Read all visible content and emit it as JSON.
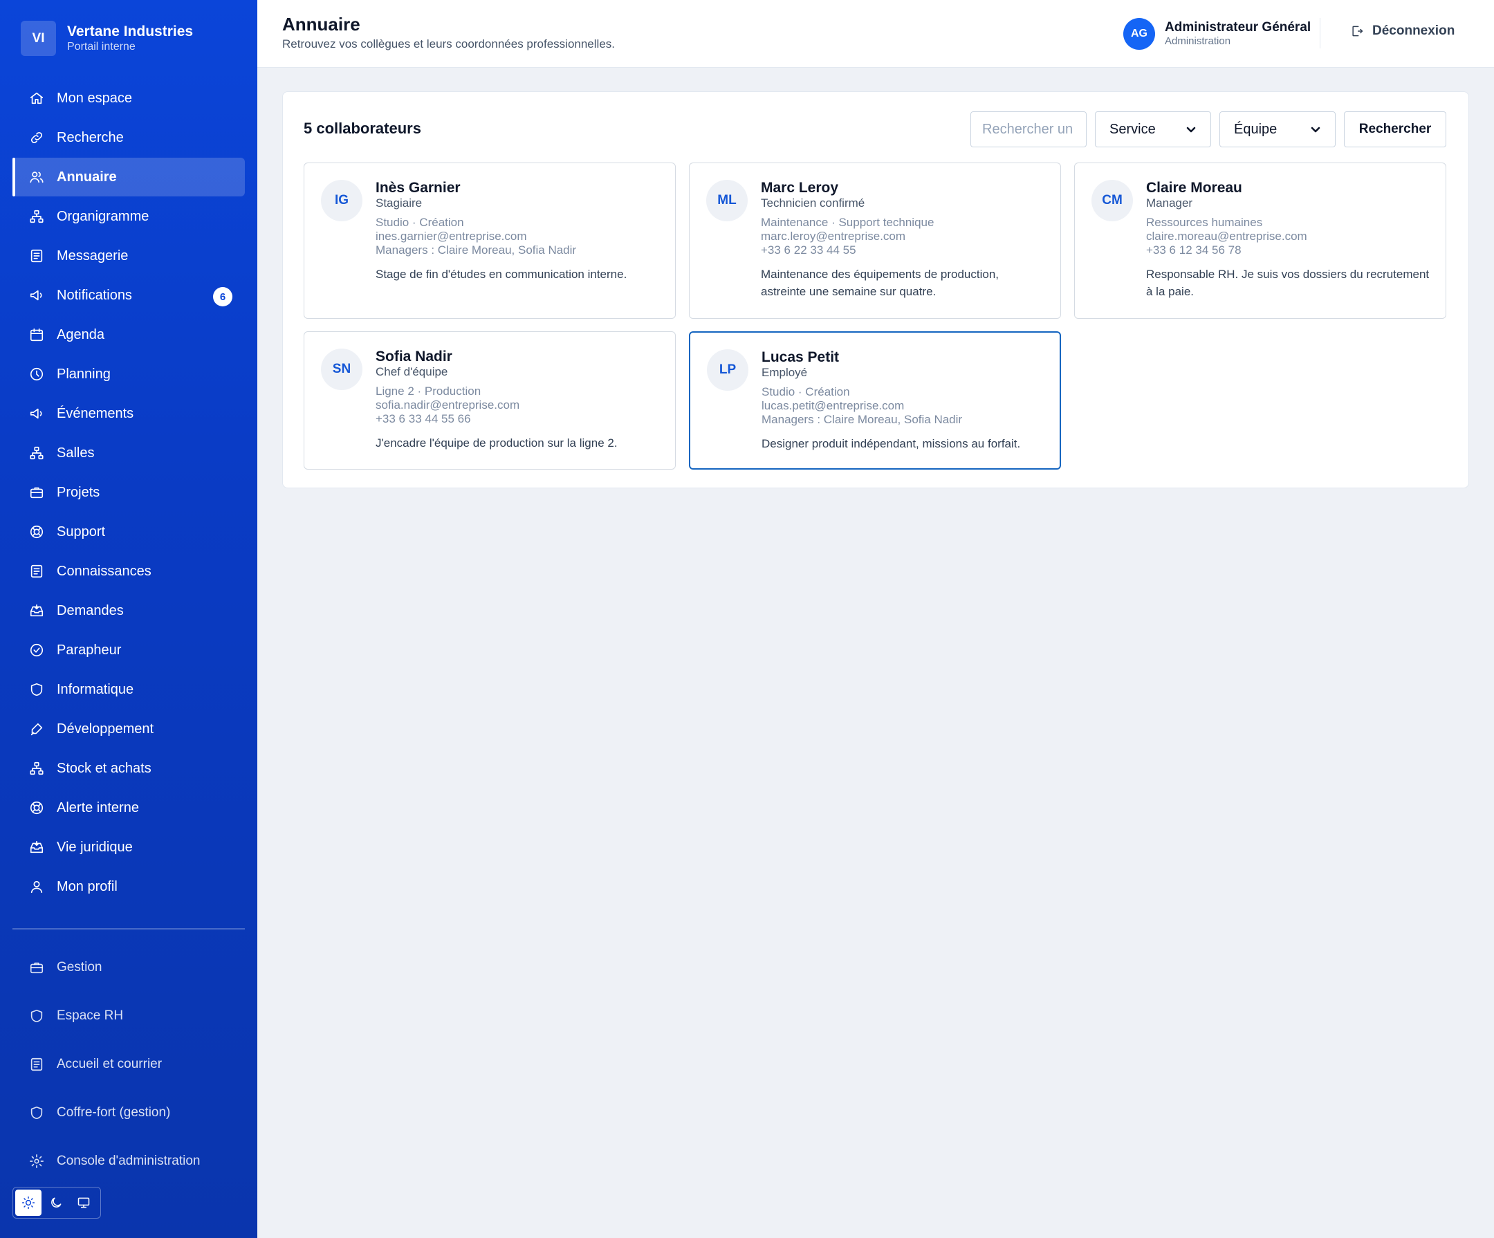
{
  "brand": {
    "initials": "VI",
    "name": "Vertane Industries",
    "subtitle": "Portail interne"
  },
  "nav": [
    {
      "label": "Mon espace",
      "icon": "home-icon"
    },
    {
      "label": "Recherche",
      "icon": "link-icon"
    },
    {
      "label": "Annuaire",
      "icon": "users-icon",
      "active": true
    },
    {
      "label": "Organigramme",
      "icon": "org-chart-icon"
    },
    {
      "label": "Messagerie",
      "icon": "document-icon"
    },
    {
      "label": "Notifications",
      "icon": "megaphone-icon",
      "badge": "6"
    },
    {
      "label": "Agenda",
      "icon": "calendar-icon"
    },
    {
      "label": "Planning",
      "icon": "clock-icon"
    },
    {
      "label": "Événements",
      "icon": "megaphone-icon"
    },
    {
      "label": "Salles",
      "icon": "org-chart-icon"
    },
    {
      "label": "Projets",
      "icon": "briefcase-icon"
    },
    {
      "label": "Support",
      "icon": "lifebuoy-icon"
    },
    {
      "label": "Connaissances",
      "icon": "document-icon"
    },
    {
      "label": "Demandes",
      "icon": "inbox-icon"
    },
    {
      "label": "Parapheur",
      "icon": "check-circle-icon"
    },
    {
      "label": "Informatique",
      "icon": "shield-icon"
    },
    {
      "label": "Développement",
      "icon": "pen-icon"
    },
    {
      "label": "Stock et achats",
      "icon": "org-chart-icon"
    },
    {
      "label": "Alerte interne",
      "icon": "lifebuoy-icon"
    },
    {
      "label": "Vie juridique",
      "icon": "inbox-icon"
    },
    {
      "label": "Mon profil",
      "icon": "user-icon"
    }
  ],
  "nav_secondary": [
    {
      "label": "Gestion",
      "icon": "briefcase-icon"
    },
    {
      "label": "Espace RH",
      "icon": "shield-icon"
    },
    {
      "label": "Accueil et courrier",
      "icon": "document-icon"
    },
    {
      "label": "Coffre-fort (gestion)",
      "icon": "shield-icon"
    },
    {
      "label": "Console d'administration",
      "icon": "gear-icon"
    }
  ],
  "theme_switcher": {
    "options": [
      "light",
      "dark",
      "system"
    ],
    "selected": "light"
  },
  "header": {
    "title": "Annuaire",
    "subtitle": "Retrouvez vos collègues et leurs coordonnées professionnelles.",
    "user": {
      "initials": "AG",
      "name": "Administrateur Général",
      "role": "Administration"
    },
    "logout_label": "Déconnexion"
  },
  "directory": {
    "count_label": "5 collaborateurs",
    "search_placeholder": "Rechercher un collaborateur",
    "service_select": "Service",
    "team_select": "Équipe",
    "search_button": "Rechercher",
    "people": [
      {
        "initials": "IG",
        "name": "Inès Garnier",
        "role": "Stagiaire",
        "meta": [
          "Studio · Création",
          "ines.garnier@entreprise.com",
          "Managers : Claire Moreau, Sofia Nadir"
        ],
        "description": "Stage de fin d'études en communication interne."
      },
      {
        "initials": "ML",
        "name": "Marc Leroy",
        "role": "Technicien confirmé",
        "meta": [
          "Maintenance · Support technique",
          "marc.leroy@entreprise.com",
          "+33 6 22 33 44 55"
        ],
        "description": "Maintenance des équipements de production, astreinte une semaine sur quatre."
      },
      {
        "initials": "CM",
        "name": "Claire Moreau",
        "role": "Manager",
        "meta": [
          "Ressources humaines",
          "claire.moreau@entreprise.com",
          "+33 6 12 34 56 78"
        ],
        "description": "Responsable RH. Je suis vos dossiers du recrutement à la paie."
      },
      {
        "initials": "SN",
        "name": "Sofia Nadir",
        "role": "Chef d'équipe",
        "meta": [
          "Ligne 2 · Production",
          "sofia.nadir@entreprise.com",
          "+33 6 33 44 55 66"
        ],
        "description": "J'encadre l'équipe de production sur la ligne 2."
      },
      {
        "initials": "LP",
        "name": "Lucas Petit",
        "role": "Employé",
        "meta": [
          "Studio · Création",
          "lucas.petit@entreprise.com",
          "Managers : Claire Moreau, Sofia Nadir"
        ],
        "description": "Designer produit indépendant, missions au forfait.",
        "selected": true
      }
    ]
  }
}
